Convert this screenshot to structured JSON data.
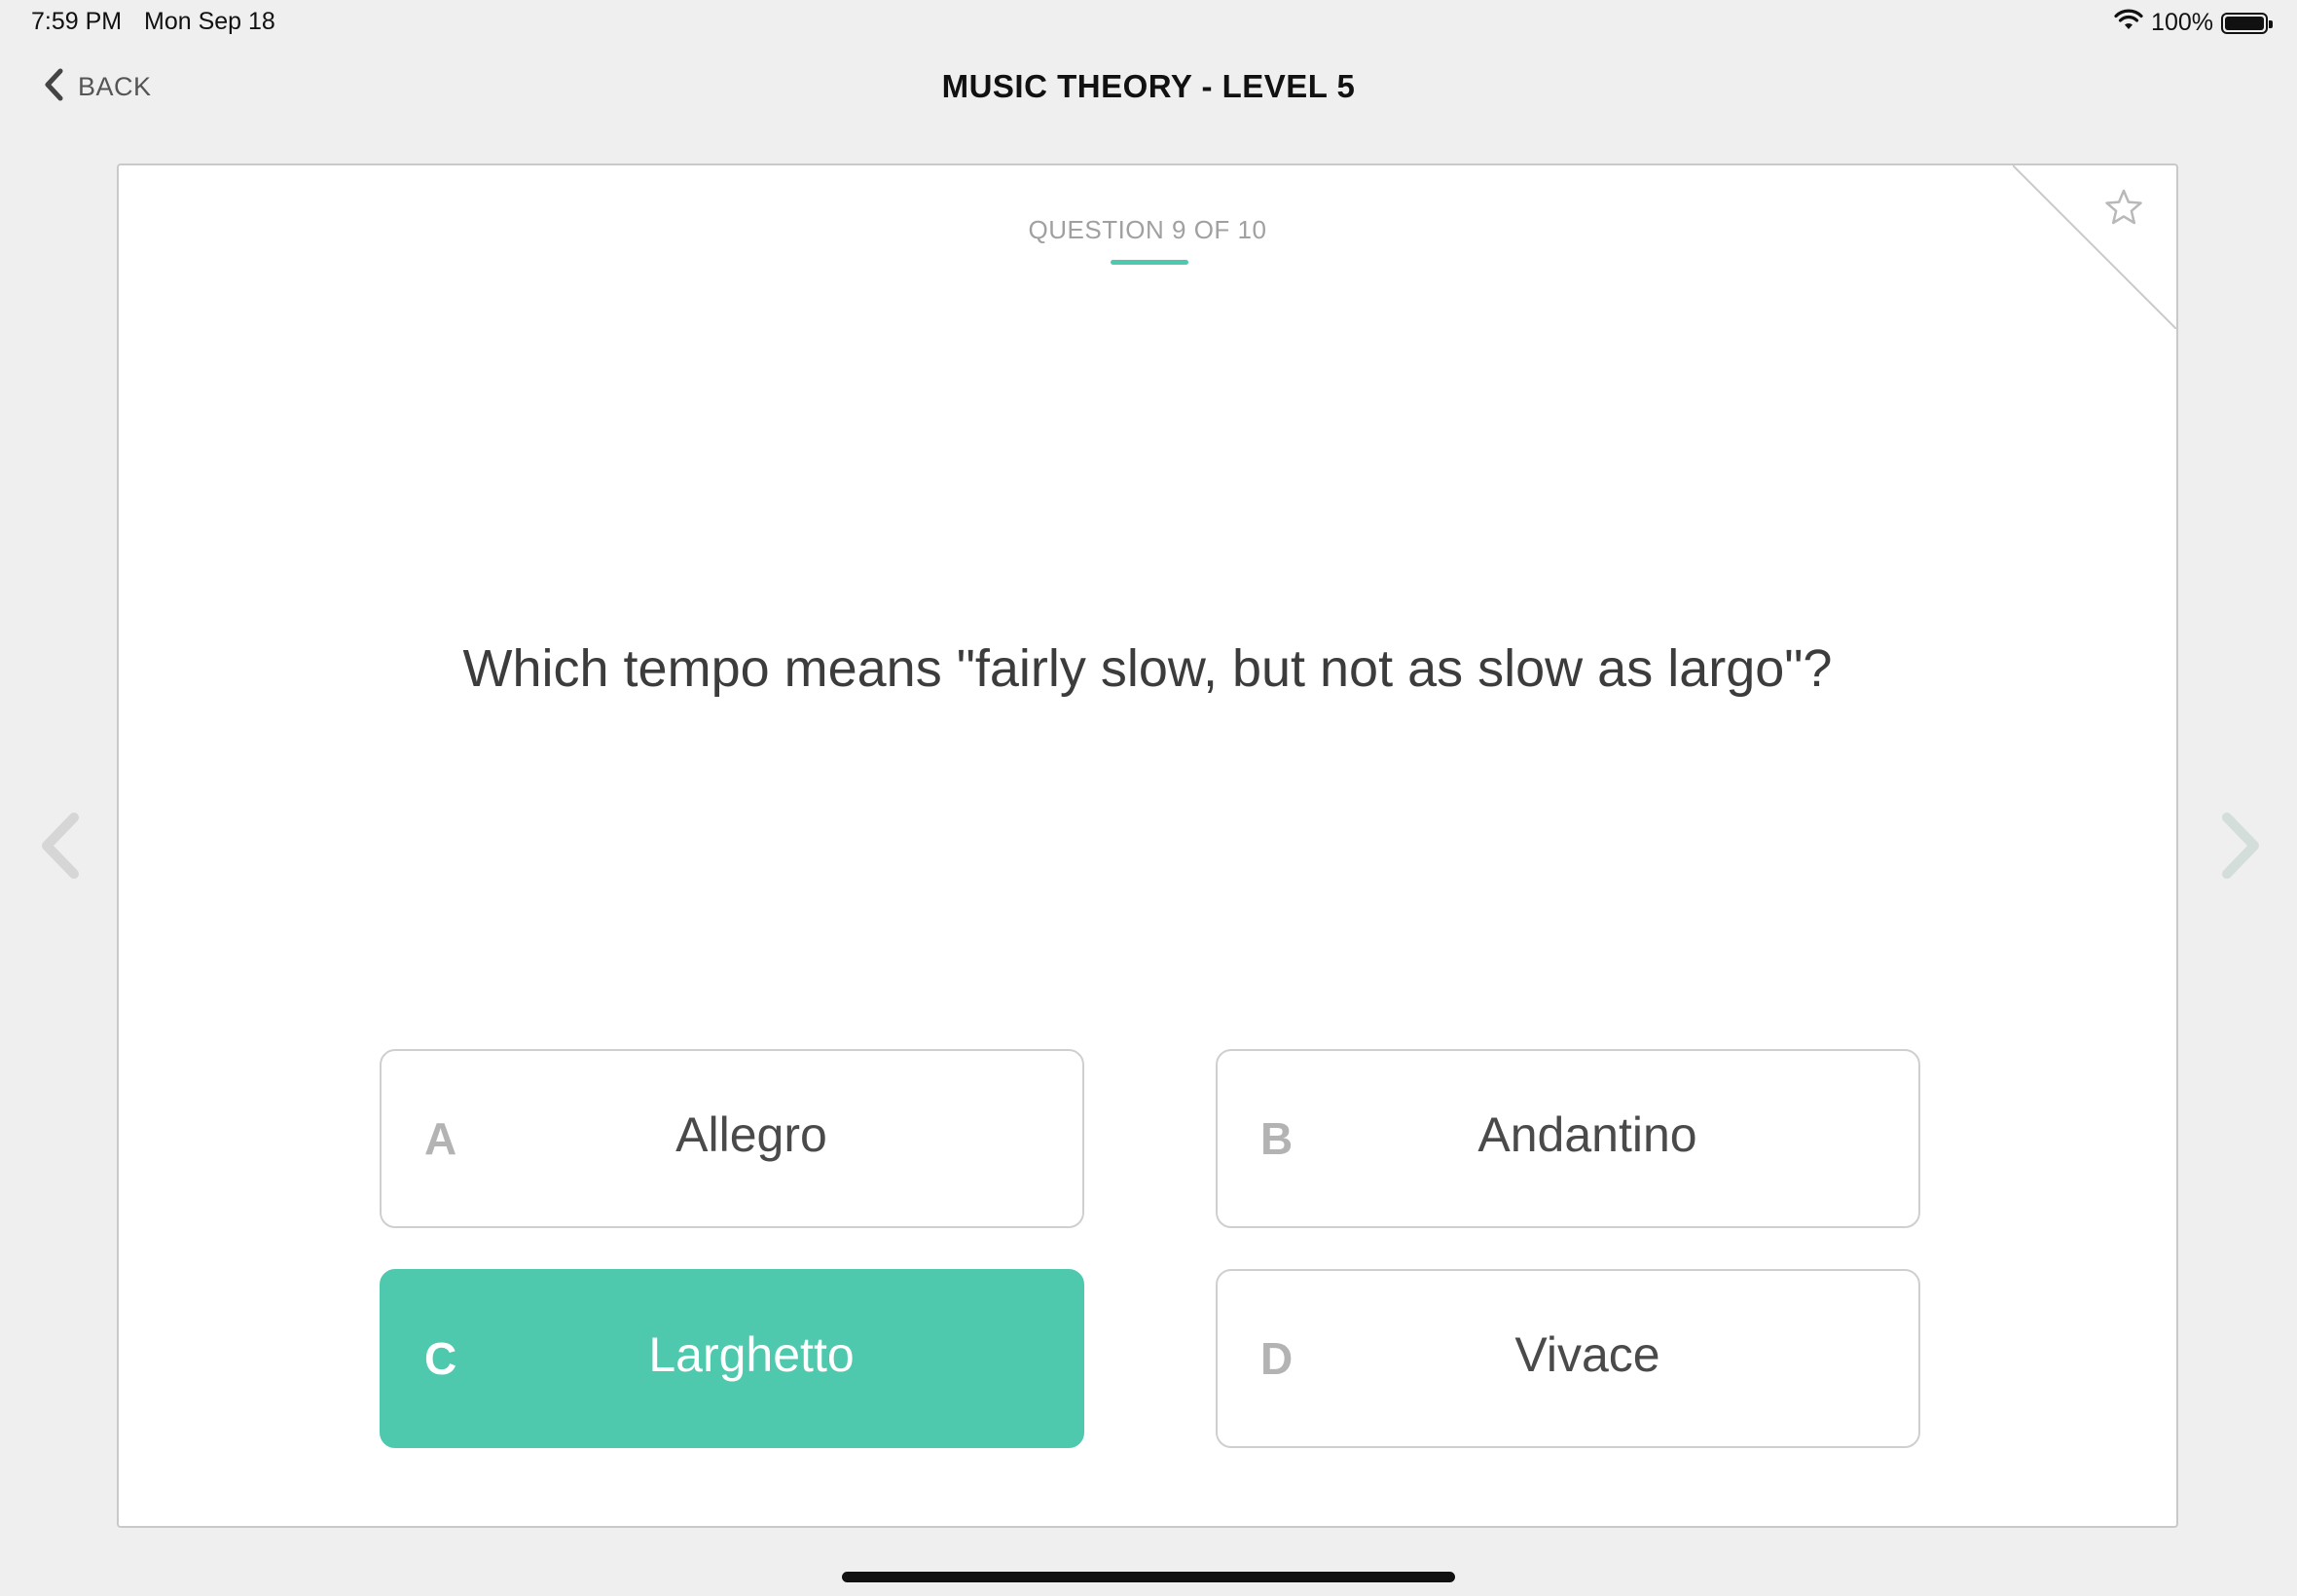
{
  "status_bar": {
    "time": "7:59 PM",
    "date": "Mon Sep 18",
    "battery": "100%",
    "wifi_icon": "wifi-icon",
    "battery_icon": "battery-full-icon"
  },
  "nav": {
    "back_label": "BACK",
    "title": "MUSIC THEORY - LEVEL 5"
  },
  "quiz": {
    "counter": "QUESTION 9 OF 10",
    "question": "Which tempo means \"fairly slow, but not as slow as largo\"?",
    "accent_color": "#4ec9ae",
    "answers": [
      {
        "letter": "A",
        "label": "Allegro",
        "selected": false
      },
      {
        "letter": "B",
        "label": "Andantino",
        "selected": false
      },
      {
        "letter": "C",
        "label": "Larghetto",
        "selected": true
      },
      {
        "letter": "D",
        "label": "Vivace",
        "selected": false
      }
    ]
  },
  "icons": {
    "favorite": "star-outline-icon",
    "prev": "chevron-left-icon",
    "next": "chevron-right-icon"
  }
}
